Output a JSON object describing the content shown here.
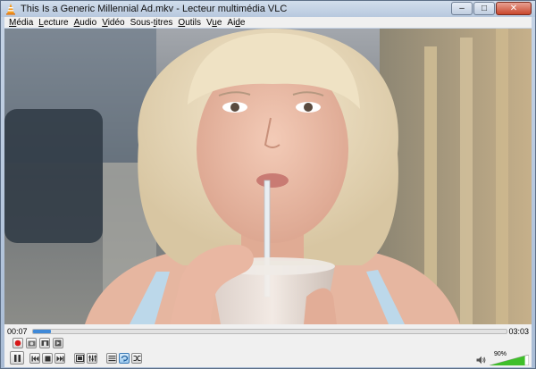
{
  "window": {
    "title": "This Is a Generic Millennial Ad.mkv - Lecteur multimédia VLC",
    "buttons": {
      "minimize": "–",
      "maximize": "□",
      "close": "✕"
    }
  },
  "menu": [
    {
      "pre": "",
      "key": "M",
      "post": "édia"
    },
    {
      "pre": "",
      "key": "L",
      "post": "ecture"
    },
    {
      "pre": "",
      "key": "A",
      "post": "udio"
    },
    {
      "pre": "",
      "key": "V",
      "post": "idéo"
    },
    {
      "pre": "Sous-",
      "key": "t",
      "post": "itres"
    },
    {
      "pre": "",
      "key": "O",
      "post": "utils"
    },
    {
      "pre": "V",
      "key": "u",
      "post": "e"
    },
    {
      "pre": "Ai",
      "key": "d",
      "post": "e"
    }
  ],
  "playback": {
    "elapsed": "00:07",
    "total": "03:03",
    "progress": 0.038
  },
  "volume": {
    "label": "90%",
    "level": 0.9
  },
  "colors": {
    "accent": "#3f89d8",
    "volume_green": "#3fbf2a",
    "record_red": "#d81818"
  },
  "icons": [
    "vlc-cone-icon",
    "record-icon",
    "snapshot-icon",
    "loop-ab-icon",
    "frame-step-icon",
    "pause-icon",
    "previous-icon",
    "stop-icon",
    "next-icon",
    "fullscreen-icon",
    "extended-settings-icon",
    "playlist-icon",
    "loop-icon",
    "shuffle-icon",
    "speaker-icon"
  ]
}
